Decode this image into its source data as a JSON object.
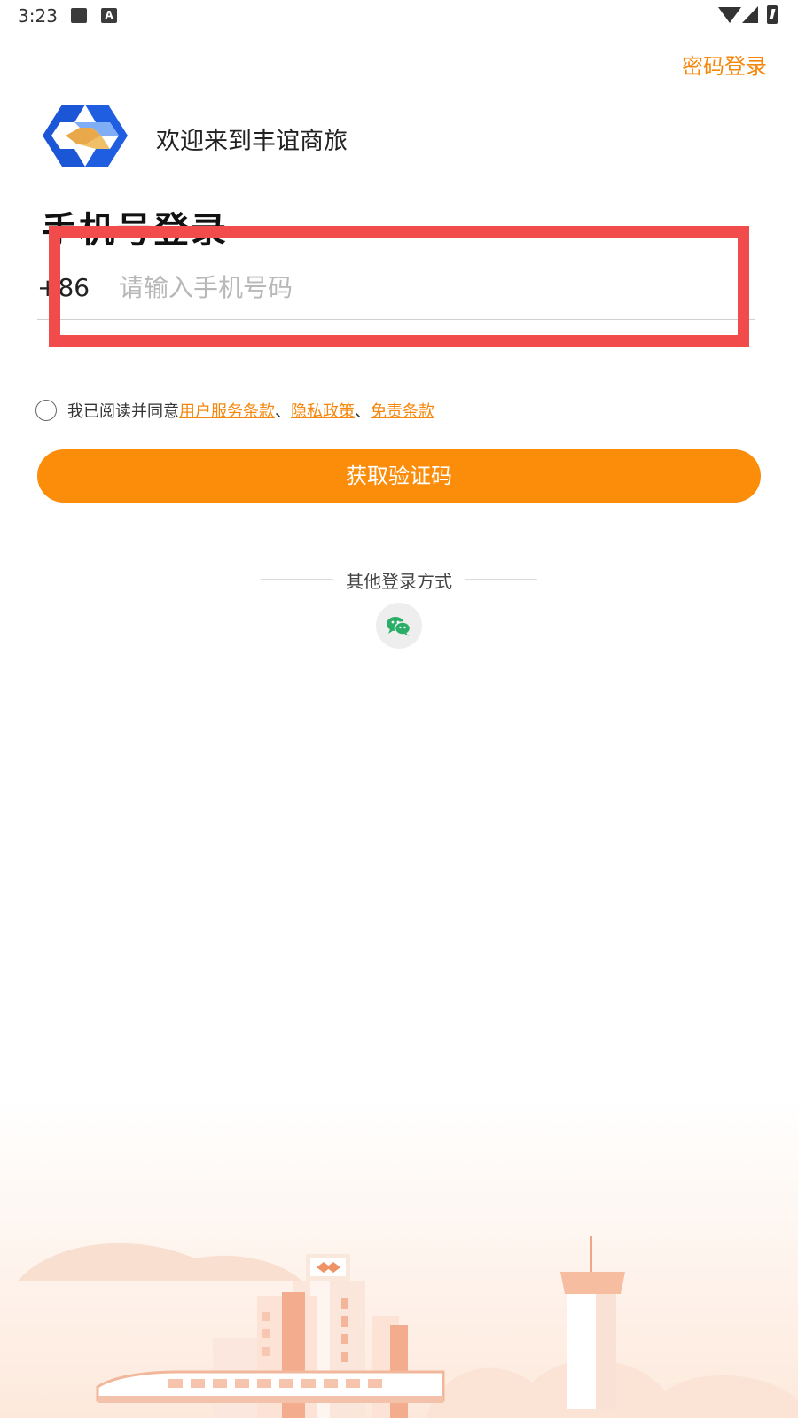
{
  "status_bar": {
    "time": "3:23",
    "notif_a_label": "A"
  },
  "header": {
    "password_login_label": "密码登录"
  },
  "brand": {
    "welcome_text": "欢迎来到丰谊商旅"
  },
  "login": {
    "title": "手机号登录"
  },
  "phone": {
    "country_code": "+86",
    "placeholder": "请输入手机号码",
    "value": ""
  },
  "agreement": {
    "prefix": "我已阅读并同意",
    "terms_label": "用户服务条款",
    "separator": "、",
    "privacy_label": "隐私政策",
    "disclaimer_label": "免责条款",
    "checked": false
  },
  "primary_button": {
    "label": "获取验证码"
  },
  "other_login": {
    "label": "其他登录方式",
    "methods": [
      "wechat"
    ]
  },
  "colors": {
    "accent": "#fb8d0b",
    "link": "#f5870c",
    "highlight": "#f24b4b",
    "logo_blue": "#1a56d6",
    "logo_gold": "#e9a94a"
  }
}
